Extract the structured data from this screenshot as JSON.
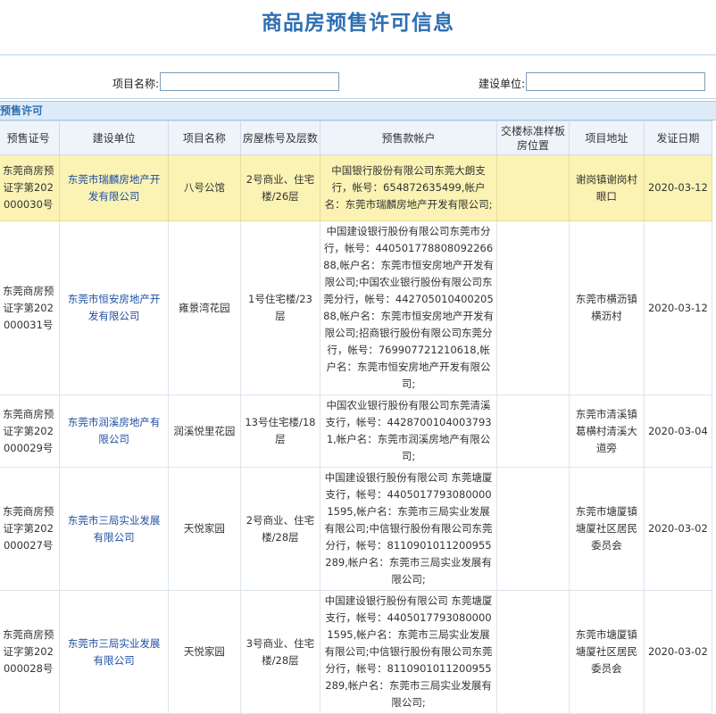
{
  "page": {
    "title": "商品房预售许可信息"
  },
  "search": {
    "project_name_label": "项目名称:",
    "project_name_value": "",
    "developer_label": "建设单位:",
    "developer_value": ""
  },
  "section": {
    "title": "预售许可"
  },
  "table": {
    "headers": [
      "预售证号",
      "建设单位",
      "项目名称",
      "房屋栋号及层数",
      "预售款帐户",
      "交楼标准样板房位置",
      "项目地址",
      "发证日期"
    ],
    "rows": [
      {
        "permit_no": "东莞商房预证字第202000030号",
        "developer": "东莞市瑞麟房地产开发有限公司",
        "project": "八号公馆",
        "building": "2号商业、住宅楼/26层",
        "account": "中国银行股份有限公司东莞大朗支行，帐号：654872635499,帐户名：东莞市瑞麟房地产开发有限公司;",
        "sample_room": "",
        "address": "谢岗镇谢岗村眼口",
        "date": "2020-03-12",
        "selected": true
      },
      {
        "permit_no": "东莞商房预证字第202000031号",
        "developer": "东莞市恒安房地产开发有限公司",
        "project": "雍景湾花园",
        "building": "1号住宅楼/23层",
        "account": "中国建设银行股份有限公司东莞市分行，帐号：44050177880809226688,帐户名：东莞市恒安房地产开发有限公司;中国农业银行股份有限公司东莞分行，帐号：44270501040020588,帐户名：东莞市恒安房地产开发有限公司;招商银行股份有限公司东莞分行，帐号：769907721210618,帐户名：东莞市恒安房地产开发有限公司;",
        "sample_room": "",
        "address": "东莞市横沥镇横沥村",
        "date": "2020-03-12",
        "selected": false
      },
      {
        "permit_no": "东莞商房预证字第202000029号",
        "developer": "东莞市润溪房地产有限公司",
        "project": "润溪悦里花园",
        "building": "13号住宅楼/18层",
        "account": "中国农业银行股份有限公司东莞清溪支行，帐号：44287001040037931,帐户名：东莞市润溪房地产有限公司;",
        "sample_room": "",
        "address": "东莞市清溪镇葛横村清溪大道旁",
        "date": "2020-03-04",
        "selected": false
      },
      {
        "permit_no": "东莞商房预证字第202000027号",
        "developer": "东莞市三局实业发展有限公司",
        "project": "天悦家园",
        "building": "2号商业、住宅楼/28层",
        "account": "中国建设银行股份有限公司 东莞塘厦支行，帐号：44050177930800001595,帐户名：东莞市三局实业发展有限公司;中信银行股份有限公司东莞分行，帐号：8110901011200955289,帐户名：东莞市三局实业发展有限公司;",
        "sample_room": "",
        "address": "东莞市塘厦镇塘厦社区居民委员会",
        "date": "2020-03-02",
        "selected": false
      },
      {
        "permit_no": "东莞商房预证字第202000028号",
        "developer": "东莞市三局实业发展有限公司",
        "project": "天悦家园",
        "building": "3号商业、住宅楼/28层",
        "account": "中国建设银行股份有限公司 东莞塘厦支行，帐号：44050177930800001595,帐户名：东莞市三局实业发展有限公司;中信银行股份有限公司东莞分行，帐号：8110901011200955289,帐户名：东莞市三局实业发展有限公司;",
        "sample_room": "",
        "address": "东莞市塘厦镇塘厦社区居民委员会",
        "date": "2020-03-02",
        "selected": false
      }
    ]
  }
}
